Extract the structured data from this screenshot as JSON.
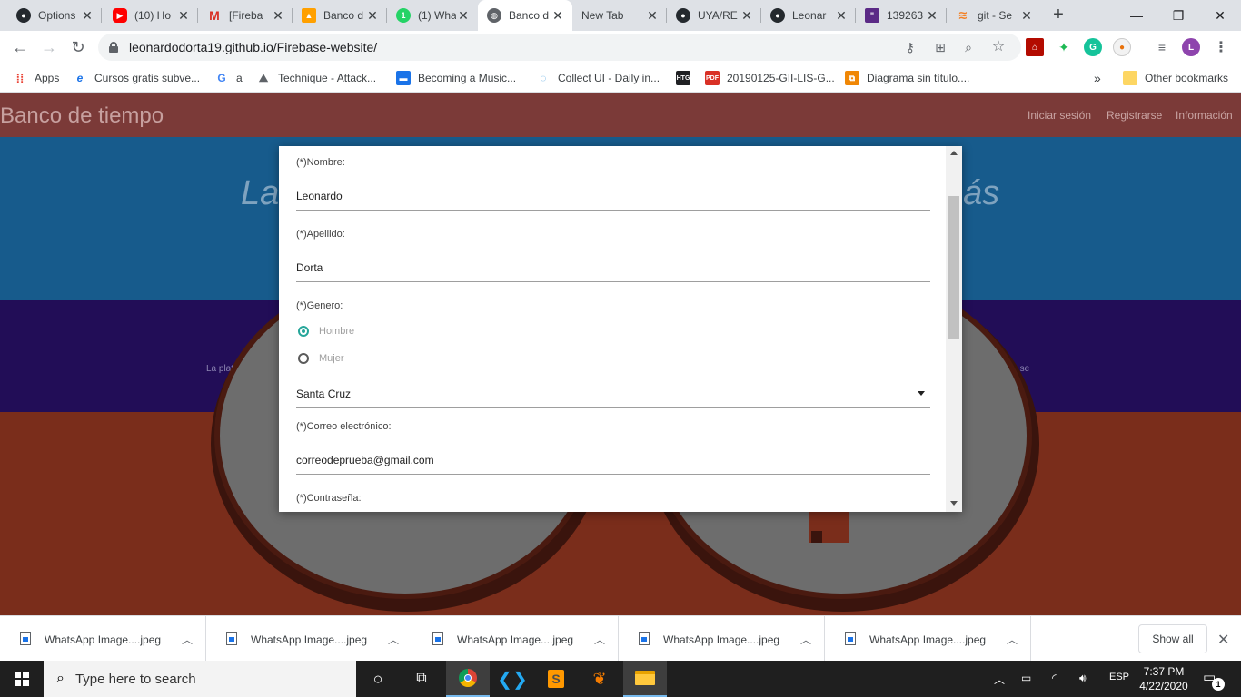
{
  "browser": {
    "tabs": [
      {
        "title": "Options",
        "favicon": "github-icon",
        "color": "#24292e"
      },
      {
        "title": "(10) Ho",
        "favicon": "youtube-icon",
        "color": "#ff0000"
      },
      {
        "title": "[Fireba",
        "favicon": "gmail-icon",
        "color": "#d93025"
      },
      {
        "title": "Banco d",
        "favicon": "firebase-icon",
        "color": "#ffa000"
      },
      {
        "title": "(1) Wha",
        "favicon": "whatsapp-icon",
        "color": "#25d366"
      },
      {
        "title": "Banco d",
        "favicon": "globe-icon",
        "color": "#5f6368"
      },
      {
        "title": "New Tab",
        "favicon": "",
        "color": ""
      },
      {
        "title": "UYA/RE",
        "favicon": "github-icon",
        "color": "#24292e"
      },
      {
        "title": "Leonar",
        "favicon": "github-icon",
        "color": "#24292e"
      },
      {
        "title": "139263",
        "favicon": "bookmark-icon",
        "color": "#5b2a86"
      },
      {
        "title": "git - Se",
        "favicon": "stackoverflow-icon",
        "color": "#f48024"
      }
    ],
    "url": "leonardodorta19.github.io/Firebase-website/",
    "profile_initial": "L",
    "bookmarks": [
      {
        "label": "Apps"
      },
      {
        "label": "Cursos gratis subve..."
      },
      {
        "label": "a"
      },
      {
        "label": "Technique - Attack..."
      },
      {
        "label": "Becoming a Music..."
      },
      {
        "label": "Collect UI - Daily in..."
      },
      {
        "label": ""
      },
      {
        "label": "20190125-GII-LIS-G..."
      },
      {
        "label": "Diagrama sin título...."
      }
    ],
    "bookmark_badges": {
      "htg": "HTG",
      "pdf": "PDF"
    },
    "other_bookmarks": "Other bookmarks",
    "overflow": "»"
  },
  "site": {
    "brand": "Banco de tiempo",
    "nav": [
      "Iniciar sesión",
      "Registrarse",
      "Información"
    ],
    "hero_left": "La",
    "hero_right": "ás",
    "band_left": "La plataforma es",
    "band_right": "Helper Coins se"
  },
  "form": {
    "nombre_label": "(*)Nombre:",
    "nombre_value": "Leonardo",
    "apellido_label": "(*)Apellido:",
    "apellido_value": "Dorta",
    "genero_label": "(*)Genero:",
    "genero_options": [
      {
        "label": "Hombre",
        "checked": true
      },
      {
        "label": "Mujer",
        "checked": false
      }
    ],
    "ciudad_value": "Santa Cruz",
    "correo_label": "(*)Correo electrónico:",
    "correo_value": "correodeprueba@gmail.com",
    "password_label": "(*)Contraseña:"
  },
  "downloads": {
    "items": [
      "WhatsApp Image....jpeg",
      "WhatsApp Image....jpeg",
      "WhatsApp Image....jpeg",
      "WhatsApp Image....jpeg",
      "WhatsApp Image....jpeg"
    ],
    "show_all": "Show all"
  },
  "taskbar": {
    "search_placeholder": "Type here to search",
    "language": "ESP",
    "time": "7:37 PM",
    "date": "4/22/2020",
    "notification_count": "1"
  },
  "colors": {
    "nav_bg": "#7b3a38",
    "hero_bg": "#175b8c",
    "band_bg": "#220d57",
    "accent_radio": "#26a69a"
  }
}
